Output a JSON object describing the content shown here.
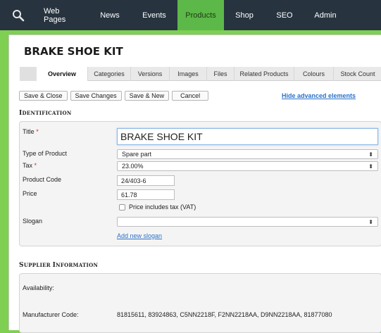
{
  "nav": {
    "search_icon": "search-icon",
    "items": [
      "Web Pages",
      "News",
      "Events",
      "Products",
      "Shop",
      "SEO",
      "Admin"
    ],
    "active": "Products"
  },
  "page": {
    "title": "BRAKE SHOE KIT"
  },
  "tabs": [
    "Overview",
    "Categories",
    "Versions",
    "Images",
    "Files",
    "Related Products",
    "Colours",
    "Stock Count"
  ],
  "actions": {
    "save_close": "Save & Close",
    "save_changes": "Save Changes",
    "save_new": "Save & New",
    "cancel": "Cancel",
    "hide_advanced": "Hide advanced elements"
  },
  "identification": {
    "heading_cap": "I",
    "heading_rest": "DENTIFICATION",
    "title_label": "Title",
    "required_mark": "*",
    "title_value": "BRAKE SHOE KIT",
    "type_label": "Type of Product",
    "type_value": "Spare part",
    "tax_label": "Tax",
    "tax_value": "23.00%",
    "code_label": "Product Code",
    "code_value": "24/403-6",
    "price_label": "Price",
    "price_value": "61.78",
    "vat_label": "Price includes tax (VAT)",
    "slogan_label": "Slogan",
    "slogan_value": "",
    "add_slogan": "Add new slogan",
    "select_arrows": "⬍"
  },
  "supplier": {
    "heading_cap1": "S",
    "heading_rest1": "UPPLIER ",
    "heading_cap2": "I",
    "heading_rest2": "NFORMATION",
    "availability_label": "Availability:",
    "manufacturer_label": "Manufacturer Code:",
    "manufacturer_value": "81815611, 83924863, C5NN2218F, F2NN2218AA, D9NN2218AA, 81877080"
  },
  "colors": {
    "nav_bg": "#27343f",
    "nav_active": "#5cb848",
    "page_border": "#7fcf52",
    "link": "#2a71c9",
    "required": "#d42a2a"
  }
}
